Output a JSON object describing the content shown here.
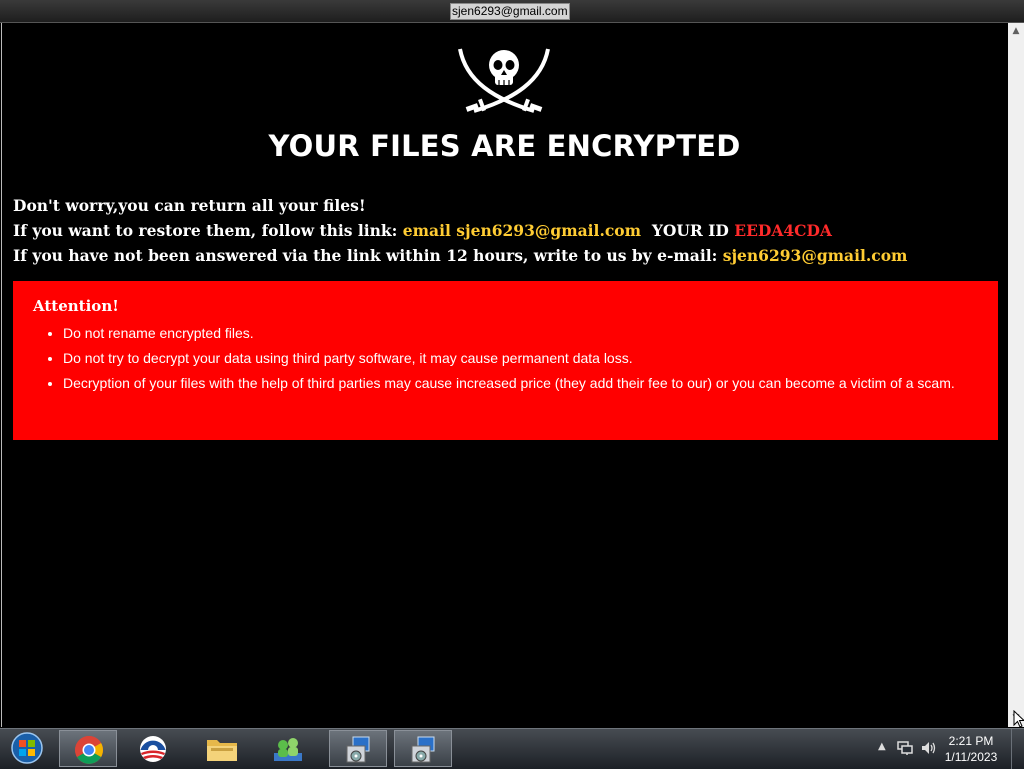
{
  "window": {
    "title": "sjen6293@gmail.com"
  },
  "note": {
    "headline": "YOUR FILES ARE ENCRYPTED",
    "line1": "Don't worry,you can return all your files!",
    "line2_prefix": "If you want to restore them, follow this link: ",
    "line2_link": "email sjen6293@gmail.com",
    "line2_id_label": "YOUR ID ",
    "line2_id": "EEDA4CDA",
    "line3_prefix": "If you have not been answered via the link within 12 hours, write to us by e-mail: ",
    "line3_email": "sjen6293@gmail.com",
    "attention_title": "Attention!",
    "bullets": [
      "Do not rename encrypted files.",
      "Do not try to decrypt your data using third party software, it may cause permanent data loss.",
      "Decryption of your files with the help of third parties may cause increased price (they add their fee to our) or you can become a victim of a scam."
    ],
    "colors": {
      "link": "#ffcc33",
      "id": "#ff2a2a",
      "alert_box": "#ff0000"
    }
  },
  "taskbar": {
    "items": [
      {
        "icon": "start-orb-icon"
      },
      {
        "icon": "chrome-icon",
        "active": true
      },
      {
        "icon": "obama-logo-icon"
      },
      {
        "icon": "file-explorer-icon"
      },
      {
        "icon": "network-users-icon"
      },
      {
        "icon": "installer-icon"
      },
      {
        "icon": "installer-icon",
        "active": true
      }
    ],
    "tray": {
      "time": "2:21 PM",
      "date": "1/11/2023"
    }
  }
}
